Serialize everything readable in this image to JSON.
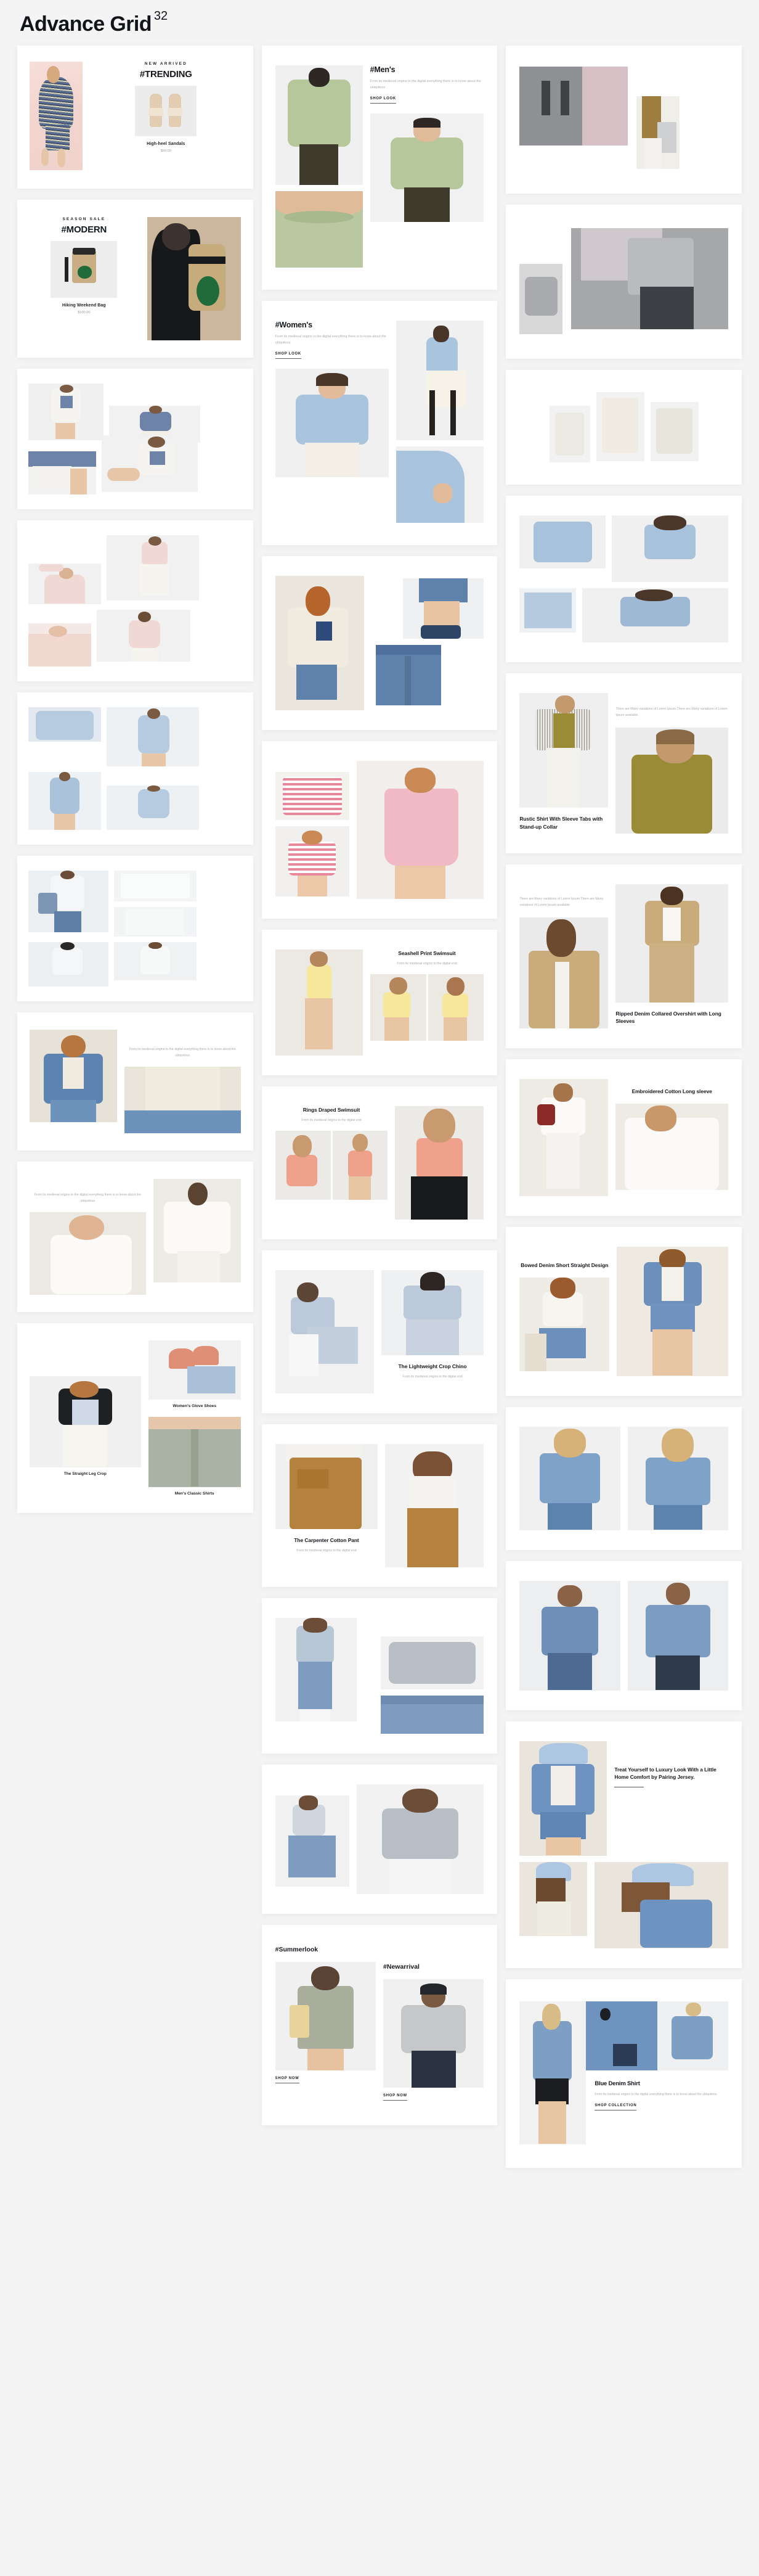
{
  "header": {
    "title": "Advance Grid",
    "superscript": "32"
  },
  "lorem": {
    "medieval_3line": "From its medieval origins to the digital everything there is to know about the ubiquitous",
    "medieval_2line": "From its medieval origins to the digital end",
    "medieval_center": "From its medieval origins to the digital everything there is to know about the ubiquitous",
    "variations": "There are Many variations of Lorem Ipsum There are Many variations of Lorem Ipsum available.",
    "blue_denim_body": "From its medieval origins to the digital everything there is to know about the ubiquitous"
  },
  "cta": {
    "shop_look": "SHOP LOOK",
    "shop_now": "SHOP NOW",
    "shop_collection": "SHOP COLLECTION"
  },
  "col1": {
    "trending": {
      "eyebrow": "NEW ARRIVED",
      "hashtag": "#TRENDING",
      "product": "High-heel Sandals",
      "price": "$60.00"
    },
    "modern": {
      "eyebrow": "SEASON SALE",
      "hashtag": "#MODERN",
      "product": "Hiking Weekend Bag",
      "price": "$100.00"
    },
    "bottom": {
      "straight_leg_crop": "The Straight Leg Crop",
      "womens_glove_shoes": "Women's Glove Shoes",
      "mens_classic_shirts": "Men's Classic Shirts"
    }
  },
  "col2": {
    "mens": {
      "title": "#Men's"
    },
    "womens": {
      "title": "#Women's"
    },
    "seashell": {
      "title": "Seashell Print Swimsuit"
    },
    "rings": {
      "title": "Rings Draped Swimsuit"
    },
    "crop_chino": {
      "title": "The Lightweight Crop Chino"
    },
    "carpenter": {
      "title": "The Carpenter Cotton Pant"
    },
    "summerlook": {
      "title": "#Summerlook"
    },
    "newarrival": {
      "title": "#Newarrival"
    }
  },
  "col3": {
    "rustic": {
      "title": "Rustic Shirt With Sleeve Tabs with Stand-up Collar"
    },
    "ripped": {
      "title": "Ripped Denim Collared Overshirt with Long Sleeves"
    },
    "embroidered": {
      "title": "Embroidered Cotton Long sleeve"
    },
    "bowed": {
      "title": "Bowed Denim Short Straight Design"
    },
    "luxury": {
      "title": "Treat Yourself to Luxury Look With a Little Home Comfort by Pairing Jersey."
    },
    "blue_denim": {
      "title": "Blue Denim Shirt"
    }
  },
  "colors": {
    "page_bg": "#f4f4f4",
    "card_bg": "#ffffff",
    "heading": "#13171b",
    "muted_text": "#a7acb1",
    "rule": "#4f565d"
  }
}
